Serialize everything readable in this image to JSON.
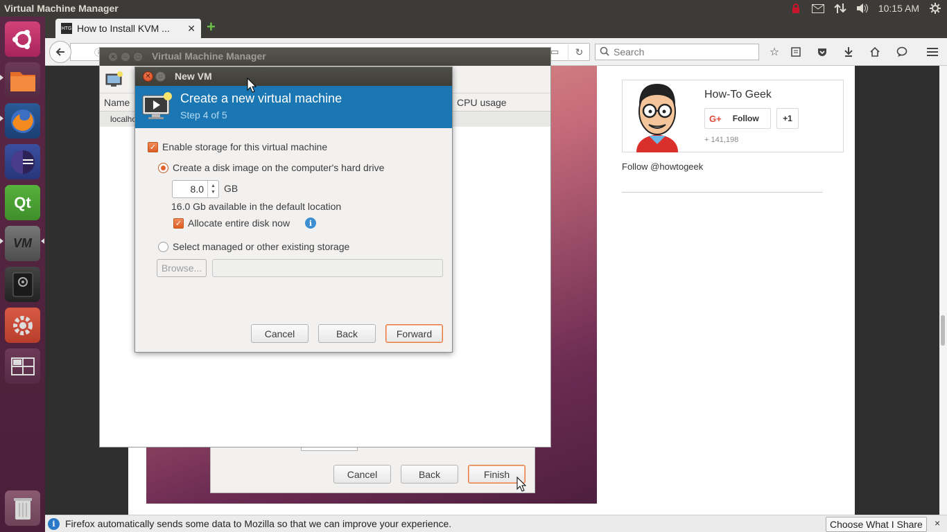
{
  "top_panel": {
    "app_title": "Virtual Machine Manager",
    "clock": "10:15 AM",
    "indicators": [
      "lock-icon",
      "mail-icon",
      "network-icon",
      "volume-icon",
      "gear-icon"
    ]
  },
  "launcher": {
    "items": [
      "ubuntu-dash",
      "files",
      "firefox",
      "eclipse",
      "qt-creator",
      "virt-manager",
      "disk-utility",
      "system-settings",
      "workspace-switcher",
      "trash"
    ]
  },
  "browser": {
    "tab_title": "How to Install KVM ...",
    "tab_favicon": "HTG",
    "search_placeholder": "Search",
    "content": {
      "gplus_name": "How-To Geek",
      "gplus_follow": "Follow",
      "gplus_g": "G+",
      "gplus_plusone": "+1",
      "gplus_count": "+ 141,198",
      "twitter_follow": "Follow @howtogeek"
    },
    "infobar": {
      "message": "Firefox automatically sends some data to Mozilla so that we can improve your experience.",
      "choose_button": "Choose What I Share",
      "close": "×"
    }
  },
  "behind_dialog": {
    "cancel": "Cancel",
    "back": "Back",
    "finish": "Finish"
  },
  "vmm": {
    "title": "Virtual Machine Manager",
    "col_name": "Name",
    "col_cpu": "CPU usage",
    "row_host": "localho"
  },
  "newvm": {
    "window_title": "New VM",
    "header_title": "Create a new virtual machine",
    "header_step": "Step 4 of 5",
    "enable_storage_label": "Enable storage for this virtual machine",
    "enable_storage_checked": true,
    "create_disk_label": "Create a disk image on the computer's hard drive",
    "disk_size": "8.0",
    "disk_unit": "GB",
    "available_text": "16.0 Gb available in the default location",
    "allocate_label": "Allocate entire disk now",
    "allocate_checked": true,
    "select_managed_label": "Select managed or other existing storage",
    "browse_label": "Browse...",
    "path_value": "",
    "cancel": "Cancel",
    "back": "Back",
    "forward": "Forward"
  },
  "colors": {
    "header_blue": "#1a77b3",
    "ubuntu_orange": "#e0632b",
    "launcher_purple": "#5b2845",
    "panel_dark": "#3c3b37"
  }
}
